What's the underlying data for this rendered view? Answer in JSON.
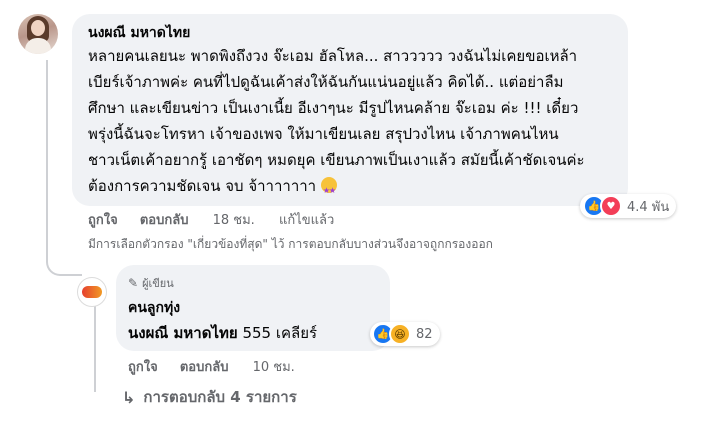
{
  "comment": {
    "author": "นงผณี มหาดไทย",
    "lines": [
      "หลายคนเลยนะ พาดพิงถึงวง จ๊ะเอม ฮัลโหล... สาววววว วงฉันไม่เคยขอเหล้า",
      "เบียร์เจ้าภาพค่ะ คนที่ไปดูฉันเค้าส่งให้ฉันกันแน่นอยู่แล้ว คิดได้.. แต่อย่าลืม",
      "ศึกษา และเขียนข่าว เป็นเงาเนี้ย อีเงาๆนะ มีรูปไหนคล้าย จ๊ะเอม ค่ะ !!! เดี๋ยว",
      "พรุ่งนี้ฉันจะโทรหา เจ้าของเพจ ให้มาเขียนเลย สรุปวงไหน เจ้าภาพคนไหน",
      "ชาวเน็ตเค้าอยากรู้ เอาชัดๆ หมดยุค เขียนภาพเป็นเงาแล้ว สมัยนี้เค้าชัดเจนค่ะ",
      "ต้องการความชัดเจน จบ จ้าาาาาาา"
    ],
    "reactions_count": "4.4 พัน",
    "like_label": "ถูกใจ",
    "reply_label": "ตอบกลับ",
    "time": "18 ชม.",
    "edited": "แก้ไขแล้ว"
  },
  "filter_note": "มีการเลือกตัวกรอง \"เกี่ยวข้องที่สุด\" ไว้ การตอบกลับบางส่วนจึงอาจถูกกรองออก",
  "reply": {
    "badge": "ผู้เขียน",
    "author": "คนลูกทุ่ง",
    "mention": "นงผณี มหาดไทย",
    "text": "555 เคลียร์",
    "reactions_count": "82",
    "like_label": "ถูกใจ",
    "reply_label": "ตอบกลับ",
    "time": "10 ชม."
  },
  "more_replies": "การตอบกลับ 4 รายการ",
  "icons": {
    "like": "like-icon",
    "love": "love-icon",
    "haha": "haha-icon",
    "star_struck": "star-struck-emoji-icon",
    "pencil": "pencil-icon",
    "reply_arrow": "reply-arrow-icon"
  },
  "colors": {
    "like": "#1877f2",
    "love": "#f33e58",
    "haha": "#f7b125",
    "bubble": "#f0f2f5",
    "muted": "#65676b"
  }
}
